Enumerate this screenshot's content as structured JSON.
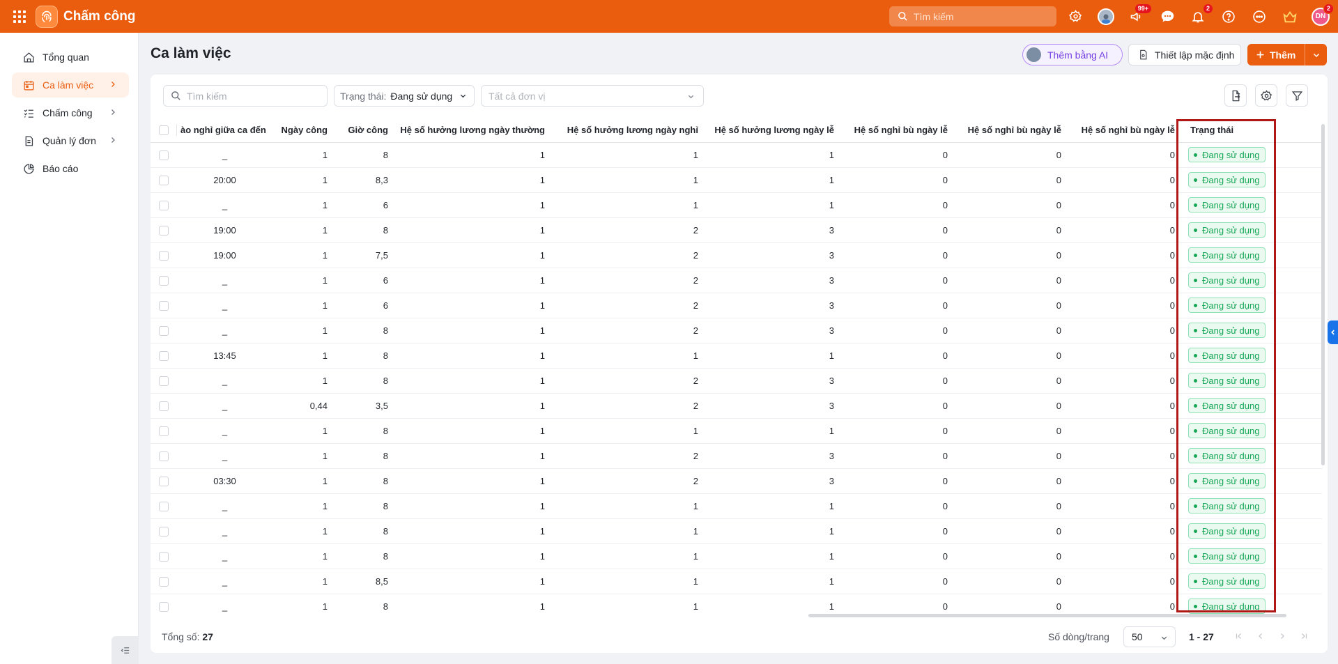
{
  "app": {
    "name": "Chấm công",
    "search_placeholder": "Tìm kiếm",
    "chat_badge": "99+",
    "notif_badge": "2",
    "user_initials": "DN",
    "user_badge": "2"
  },
  "sidebar": {
    "items": [
      {
        "label": "Tổng quan",
        "icon": "home-icon"
      },
      {
        "label": "Ca làm việc",
        "icon": "calendar-icon"
      },
      {
        "label": "Chấm công",
        "icon": "checklist-icon"
      },
      {
        "label": "Quản lý đơn",
        "icon": "document-icon"
      },
      {
        "label": "Báo cáo",
        "icon": "pie-chart-icon"
      }
    ]
  },
  "page": {
    "title": "Ca làm việc",
    "btn_ai": "Thêm bằng AI",
    "btn_default": "Thiết lập mặc định",
    "btn_add": "Thêm"
  },
  "filters": {
    "search_placeholder": "Tìm kiếm",
    "status_label": "Trạng thái:",
    "status_value": "Đang sử dụng",
    "unit_placeholder": "Tất cả đơn vị"
  },
  "table": {
    "columns": [
      "ào nghỉ giữa ca đến",
      "Ngày công",
      "Giờ công",
      "Hệ số hưởng lương ngày thường",
      "Hệ số hưởng lương ngày nghỉ",
      "Hệ số hưởng lương ngày lễ",
      "Hệ số nghỉ bù ngày lễ",
      "Hệ số nghỉ bù ngày lễ",
      "Hệ số nghỉ bù ngày lễ",
      "Trạng thái"
    ],
    "rows": [
      [
        "_",
        "1",
        "8",
        "1",
        "1",
        "1",
        "0",
        "0",
        "0",
        "Đang sử dụng"
      ],
      [
        "20:00",
        "1",
        "8,3",
        "1",
        "1",
        "1",
        "0",
        "0",
        "0",
        "Đang sử dụng"
      ],
      [
        "_",
        "1",
        "6",
        "1",
        "1",
        "1",
        "0",
        "0",
        "0",
        "Đang sử dụng"
      ],
      [
        "19:00",
        "1",
        "8",
        "1",
        "2",
        "3",
        "0",
        "0",
        "0",
        "Đang sử dụng"
      ],
      [
        "19:00",
        "1",
        "7,5",
        "1",
        "2",
        "3",
        "0",
        "0",
        "0",
        "Đang sử dụng"
      ],
      [
        "_",
        "1",
        "6",
        "1",
        "2",
        "3",
        "0",
        "0",
        "0",
        "Đang sử dụng"
      ],
      [
        "_",
        "1",
        "6",
        "1",
        "2",
        "3",
        "0",
        "0",
        "0",
        "Đang sử dụng"
      ],
      [
        "_",
        "1",
        "8",
        "1",
        "2",
        "3",
        "0",
        "0",
        "0",
        "Đang sử dụng"
      ],
      [
        "13:45",
        "1",
        "8",
        "1",
        "1",
        "1",
        "0",
        "0",
        "0",
        "Đang sử dụng"
      ],
      [
        "_",
        "1",
        "8",
        "1",
        "2",
        "3",
        "0",
        "0",
        "0",
        "Đang sử dụng"
      ],
      [
        "_",
        "0,44",
        "3,5",
        "1",
        "2",
        "3",
        "0",
        "0",
        "0",
        "Đang sử dụng"
      ],
      [
        "_",
        "1",
        "8",
        "1",
        "1",
        "1",
        "0",
        "0",
        "0",
        "Đang sử dụng"
      ],
      [
        "_",
        "1",
        "8",
        "1",
        "2",
        "3",
        "0",
        "0",
        "0",
        "Đang sử dụng"
      ],
      [
        "03:30",
        "1",
        "8",
        "1",
        "2",
        "3",
        "0",
        "0",
        "0",
        "Đang sử dụng"
      ],
      [
        "_",
        "1",
        "8",
        "1",
        "1",
        "1",
        "0",
        "0",
        "0",
        "Đang sử dụng"
      ],
      [
        "_",
        "1",
        "8",
        "1",
        "1",
        "1",
        "0",
        "0",
        "0",
        "Đang sử dụng"
      ],
      [
        "_",
        "1",
        "8",
        "1",
        "1",
        "1",
        "0",
        "0",
        "0",
        "Đang sử dụng"
      ],
      [
        "_",
        "1",
        "8,5",
        "1",
        "1",
        "1",
        "0",
        "0",
        "0",
        "Đang sử dụng"
      ],
      [
        "_",
        "1",
        "8",
        "1",
        "1",
        "1",
        "0",
        "0",
        "0",
        "Đang sử dụng"
      ]
    ]
  },
  "footer": {
    "total_label": "Tổng số:",
    "total_value": "27",
    "rows_label": "Số dòng/trang",
    "rows_value": "50",
    "range": "1 - 27"
  }
}
